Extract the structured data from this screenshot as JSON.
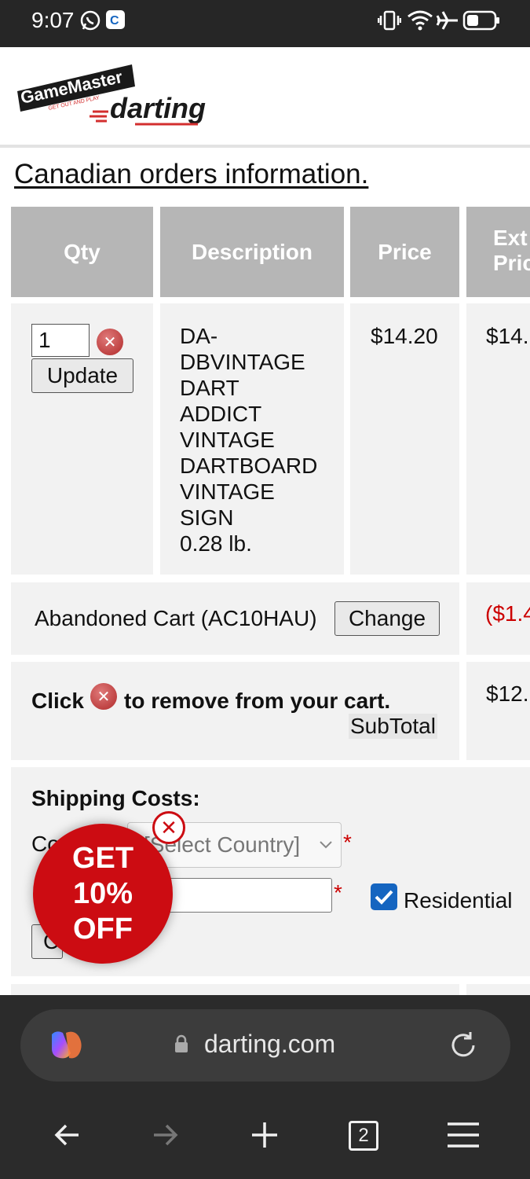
{
  "status_bar": {
    "time": "9:07"
  },
  "header": {
    "logo_brand": "GameMaster",
    "logo_tagline": "GET OUT AND PLAY",
    "logo_product": "darting"
  },
  "canadian_link": "Canadian orders information.",
  "table": {
    "headers": [
      "Qty",
      "Description",
      "Price",
      "Ext Pric"
    ],
    "header_ext_line1": "Ext",
    "header_ext_line2": "Pric",
    "item": {
      "qty": "1",
      "update_label": "Update",
      "description_lines": [
        "DA-",
        "DBVINTAGE",
        "DART",
        "ADDICT",
        "VINTAGE",
        "DARTBOARD",
        "VINTAGE",
        "SIGN",
        "0.28 lb."
      ],
      "price": "$14.20",
      "ext_price": "$14."
    },
    "discount": {
      "label": "Abandoned Cart (AC10HAU)",
      "change_label": "Change",
      "amount": "($1.4"
    },
    "subtotal": {
      "click_label": "Click",
      "remove_text": "to remove from your cart.",
      "subtotal_label": "SubTotal",
      "amount": "$12."
    }
  },
  "shipping": {
    "title": "Shipping Costs:",
    "country_label_partial": "Co",
    "country_placeholder": "[Select Country]",
    "required_mark": "*",
    "residential_label": "Residential",
    "residential_checked": true,
    "button_partial": "C"
  },
  "promo": {
    "line1": "GET",
    "line2": "10%",
    "line3": "OFF"
  },
  "browser": {
    "url": "darting.com",
    "tab_count": "2"
  },
  "colors": {
    "header_gray": "#b6b6b6",
    "cell_bg": "#f2f2f2",
    "promo_red": "#cc0c12",
    "discount_red": "#cc0000",
    "checkbox_blue": "#1565c0"
  }
}
